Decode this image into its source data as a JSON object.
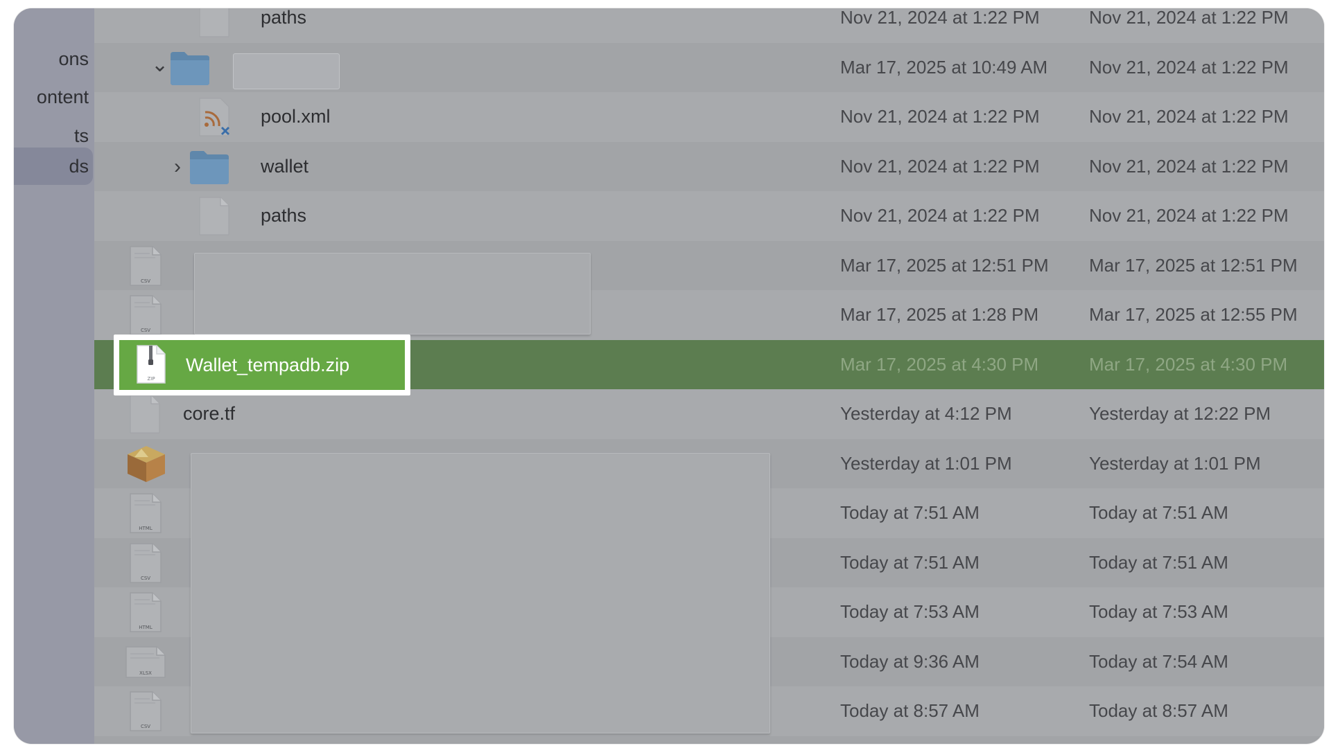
{
  "sidebar": {
    "items": [
      {
        "label": "ons"
      },
      {
        "label": "ontent"
      },
      {
        "label": "ts"
      },
      {
        "label": "ds"
      }
    ]
  },
  "files": [
    {
      "name": "paths",
      "icon": "generic-document-icon",
      "modified": "Nov 21, 2024 at 1:22 PM",
      "created": "Nov 21, 2024 at 1:22 PM"
    },
    {
      "name": "",
      "icon": "folder-icon",
      "expanded": true,
      "renaming": true,
      "modified": "Mar 17, 2025 at 10:49 AM",
      "created": "Nov 21, 2024 at 1:22 PM"
    },
    {
      "name": "pool.xml",
      "icon": "xml-rss-icon",
      "modified": "Nov 21, 2024 at 1:22 PM",
      "created": "Nov 21, 2024 at 1:22 PM"
    },
    {
      "name": "wallet",
      "icon": "folder-icon",
      "expanded": false,
      "modified": "Nov 21, 2024 at 1:22 PM",
      "created": "Nov 21, 2024 at 1:22 PM"
    },
    {
      "name": "paths",
      "icon": "generic-document-icon",
      "modified": "Nov 21, 2024 at 1:22 PM",
      "created": "Nov 21, 2024 at 1:22 PM"
    },
    {
      "name": "",
      "icon": "csv-file-icon",
      "type_label": "CSV",
      "modified": "Mar 17, 2025 at 12:51 PM",
      "created": "Mar 17, 2025 at 12:51 PM"
    },
    {
      "name": "",
      "icon": "csv-file-icon",
      "type_label": "CSV",
      "modified": "Mar 17, 2025 at 1:28 PM",
      "created": "Mar 17, 2025 at 12:55 PM"
    },
    {
      "name": "Wallet_tempadb.zip",
      "icon": "zip-file-icon",
      "type_label": "ZIP",
      "selected": true,
      "modified": "Mar 17, 2025 at 4:30 PM",
      "created": "Mar 17, 2025 at 4:30 PM"
    },
    {
      "name": "core.tf",
      "icon": "generic-document-icon",
      "modified": "Yesterday at 4:12 PM",
      "created": "Yesterday at 12:22 PM"
    },
    {
      "name": "",
      "icon": "package-box-icon",
      "modified": "Yesterday at 1:01 PM",
      "created": "Yesterday at 1:01 PM"
    },
    {
      "name": "",
      "icon": "html-file-icon",
      "type_label": "HTML",
      "modified": "Today at 7:51 AM",
      "created": "Today at 7:51 AM"
    },
    {
      "name": "",
      "icon": "csv-file-icon",
      "type_label": "CSV",
      "modified": "Today at 7:51 AM",
      "created": "Today at 7:51 AM"
    },
    {
      "name": "",
      "icon": "html-file-icon",
      "type_label": "HTML",
      "modified": "Today at 7:53 AM",
      "created": "Today at 7:53 AM"
    },
    {
      "name": "",
      "icon": "xlsx-file-icon",
      "type_label": "XLSX",
      "modified": "Today at 9:36 AM",
      "created": "Today at 7:54 AM"
    },
    {
      "name": "",
      "icon": "csv-file-icon",
      "type_label": "CSV",
      "modified": "Today at 8:57 AM",
      "created": "Today at 8:57 AM"
    }
  ]
}
